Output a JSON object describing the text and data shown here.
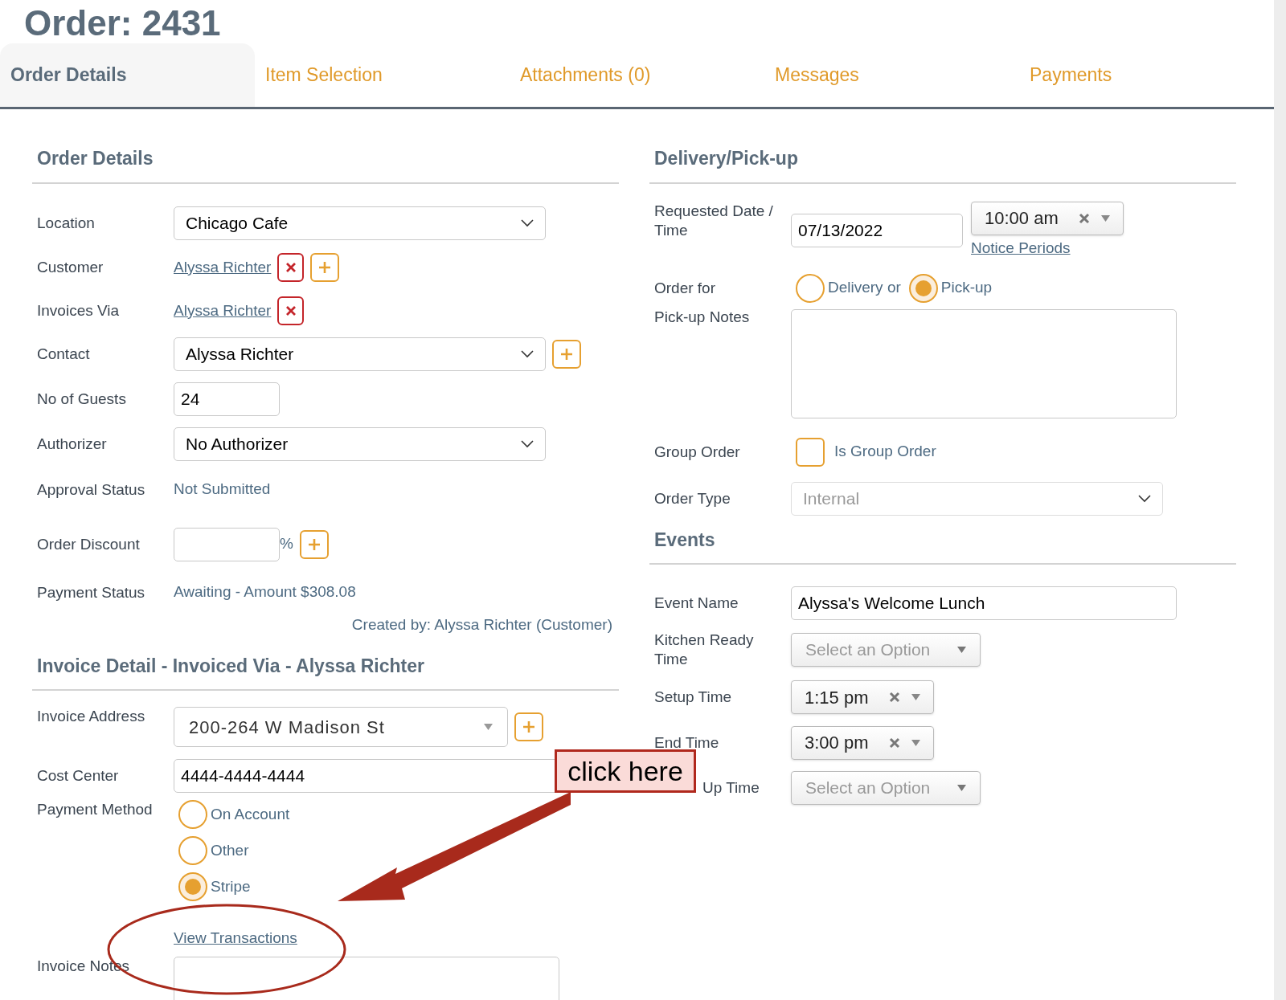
{
  "title": "Order: 2431",
  "tabs": [
    {
      "label": "Order Details",
      "selected": true
    },
    {
      "label": "Item Selection",
      "selected": false
    },
    {
      "label": "Attachments (0)",
      "selected": false
    },
    {
      "label": "Messages",
      "selected": false
    },
    {
      "label": "Payments",
      "selected": false
    }
  ],
  "order_details": {
    "heading": "Order Details",
    "rows": [
      {
        "kind": "select",
        "label": "Location",
        "value": "Chicago Cafe",
        "add": false
      },
      {
        "kind": "link",
        "label": "Customer",
        "value": "Alyssa Richter",
        "remove": true,
        "add": true
      },
      {
        "kind": "link",
        "label": "Invoices Via",
        "value": "Alyssa Richter",
        "remove": true,
        "add": false
      },
      {
        "kind": "select",
        "label": "Contact",
        "value": "Alyssa Richter",
        "add": true
      },
      {
        "kind": "input",
        "label": "No of Guests",
        "value": "24"
      },
      {
        "kind": "select",
        "label": "Authorizer",
        "value": "No Authorizer",
        "add": false
      },
      {
        "kind": "text",
        "label": "Approval Status",
        "value": "Not Submitted"
      },
      {
        "kind": "percent",
        "label": "Order Discount",
        "suffix": "%",
        "add": true
      },
      {
        "kind": "text",
        "label": "Payment Status",
        "value": "Awaiting - Amount $308.08"
      }
    ],
    "created_by": "Created by: Alyssa Richter (Customer)"
  },
  "invoice": {
    "heading": "Invoice Detail - Invoiced Via - Alyssa Richter",
    "address": {
      "label": "Invoice Address",
      "value": "200-264 W Madison St",
      "add": true
    },
    "cost_center": {
      "label": "Cost Center",
      "value": "4444-4444-4444"
    },
    "payment_method": {
      "label": "Payment Method",
      "options": [
        {
          "label": "On Account",
          "selected": false
        },
        {
          "label": "Other",
          "selected": false
        },
        {
          "label": "Stripe",
          "selected": true
        }
      ]
    },
    "transactions_link": "View Transactions",
    "notes": {
      "label": "Invoice Notes"
    }
  },
  "delivery": {
    "heading": "Delivery/Pick-up",
    "requested": {
      "label": "Requested Date / Time",
      "date": "07/13/2022",
      "time": "10:00 am",
      "link": "Notice Periods"
    },
    "order_for": {
      "label": "Order for",
      "options": [
        {
          "label": "Delivery or",
          "selected": false
        },
        {
          "label": "Pick-up",
          "selected": true
        }
      ]
    },
    "notes": {
      "label": "Pick-up Notes"
    },
    "group_order": {
      "label": "Group Order",
      "checkbox_label": "Is Group Order",
      "checked": false
    },
    "order_type": {
      "label": "Order Type",
      "value": "Internal",
      "disabled": true
    }
  },
  "events": {
    "heading": "Events",
    "rows": [
      {
        "kind": "input",
        "label": "Event Name",
        "value": "Alyssa's Welcome Lunch"
      },
      {
        "kind": "select",
        "label": "Kitchen Ready Time",
        "placeholder": "Select an Option"
      },
      {
        "kind": "time",
        "label": "Setup Time",
        "value": "1:15 pm"
      },
      {
        "kind": "time",
        "label": "End Time",
        "value": "3:00 pm"
      },
      {
        "kind": "select",
        "label": "Up Time",
        "placeholder": "Select an Option"
      }
    ]
  },
  "annotation": {
    "callout": "click here"
  }
}
